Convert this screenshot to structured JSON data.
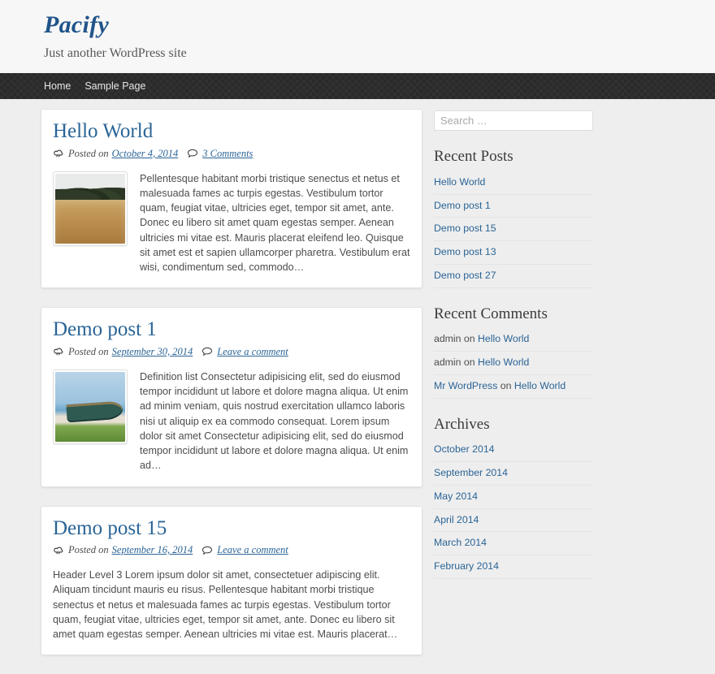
{
  "header": {
    "site_title": "Pacify",
    "tagline": "Just another WordPress site"
  },
  "nav": {
    "items": [
      {
        "label": "Home"
      },
      {
        "label": "Sample Page"
      }
    ]
  },
  "posts": [
    {
      "title": "Hello World",
      "posted_on_label": "Posted on",
      "date": "October 4, 2014",
      "comments_label": "3 Comments",
      "date_icon": "cloud-icon",
      "comments_icon": "comment-bubble-icon",
      "has_thumbnail": true,
      "thumbnail_alt": "dry golden grass field with dark trees",
      "excerpt": "Pellentesque habitant morbi tristique senectus et netus et malesuada fames ac turpis egestas. Vestibulum tortor quam, feugiat vitae, ultricies eget, tempor sit amet, ante. Donec eu libero sit amet quam egestas semper. Aenean ultricies mi vitae est. Mauris placerat eleifend leo. Quisque sit amet est et sapien ullamcorper pharetra. Vestibulum erat wisi, condimentum sed, commodo…"
    },
    {
      "title": "Demo post 1",
      "posted_on_label": "Posted on",
      "date": "September 30, 2014",
      "comments_label": "Leave a comment",
      "date_icon": "cloud-icon",
      "comments_icon": "comment-bubble-icon",
      "has_thumbnail": true,
      "thumbnail_alt": "wooden boat on beach with green grass",
      "excerpt": "Definition list Consectetur adipisicing elit, sed do eiusmod tempor incididunt ut labore et dolore magna aliqua. Ut enim ad minim veniam, quis nostrud exercitation ullamco laboris nisi ut aliquip ex ea commodo consequat. Lorem ipsum dolor sit amet Consectetur adipisicing elit, sed do eiusmod tempor incididunt ut labore et dolore magna aliqua. Ut enim ad…"
    },
    {
      "title": "Demo post 15",
      "posted_on_label": "Posted on",
      "date": "September 16, 2014",
      "comments_label": "Leave a comment",
      "date_icon": "cloud-icon",
      "comments_icon": "comment-bubble-icon",
      "has_thumbnail": false,
      "excerpt": "Header Level 3 Lorem ipsum dolor sit amet, consectetuer adipiscing elit. Aliquam tincidunt mauris eu risus. Pellentesque habitant morbi tristique senectus et netus et malesuada fames ac turpis egestas. Vestibulum tortor quam, feugiat vitae, ultricies eget, tempor sit amet, ante. Donec eu libero sit amet quam egestas semper. Aenean ultricies mi vitae est. Mauris placerat…"
    }
  ],
  "sidebar": {
    "search": {
      "placeholder": "Search …",
      "value": ""
    },
    "recent_posts": {
      "title": "Recent Posts",
      "items": [
        {
          "label": "Hello World"
        },
        {
          "label": "Demo post 1"
        },
        {
          "label": "Demo post 15"
        },
        {
          "label": "Demo post 13"
        },
        {
          "label": "Demo post 27"
        }
      ]
    },
    "recent_comments": {
      "title": "Recent Comments",
      "items": [
        {
          "author": "admin",
          "author_is_link": false,
          "on": "on",
          "post": "Hello World"
        },
        {
          "author": "admin",
          "author_is_link": false,
          "on": "on",
          "post": "Hello World"
        },
        {
          "author": "Mr WordPress",
          "author_is_link": true,
          "on": "on",
          "post": "Hello World"
        }
      ]
    },
    "archives": {
      "title": "Archives",
      "items": [
        {
          "label": "October 2014"
        },
        {
          "label": "September 2014"
        },
        {
          "label": "May 2014"
        },
        {
          "label": "April 2014"
        },
        {
          "label": "March 2014"
        },
        {
          "label": "February 2014"
        }
      ]
    }
  },
  "colors": {
    "link": "#2a6496",
    "site_title": "#20548a",
    "nav_bg": "#2a2a2a",
    "page_bg": "#eeeeee",
    "header_bg": "#f7f7f7",
    "card_bg": "#ffffff"
  }
}
